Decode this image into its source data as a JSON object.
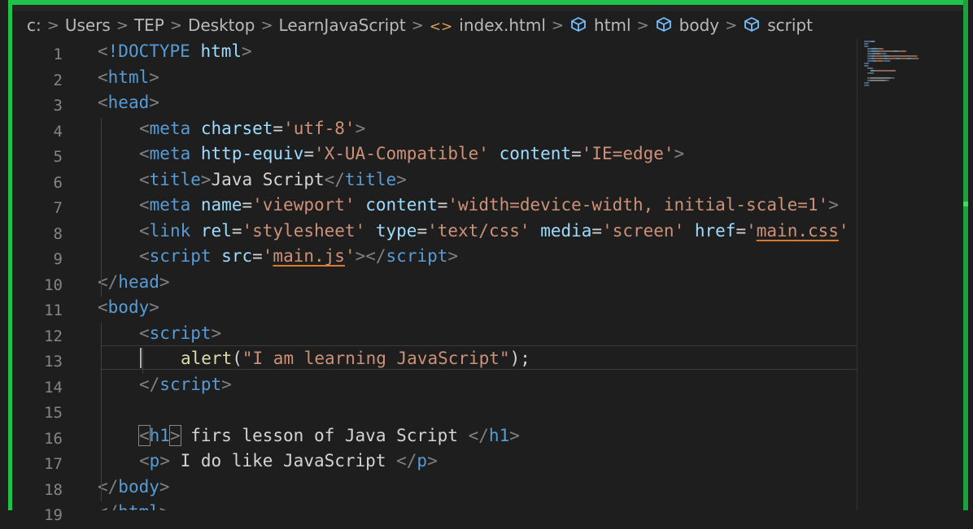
{
  "breadcrumb": {
    "items": [
      {
        "label": "c:",
        "icon": ""
      },
      {
        "label": "Users",
        "icon": ""
      },
      {
        "label": "TEP",
        "icon": ""
      },
      {
        "label": "Desktop",
        "icon": ""
      },
      {
        "label": "LearnJavaScript",
        "icon": ""
      },
      {
        "label": "index.html",
        "icon": "html-tag-icon"
      },
      {
        "label": "html",
        "icon": "symbol-cube-icon"
      },
      {
        "label": "body",
        "icon": "symbol-cube-icon"
      },
      {
        "label": "script",
        "icon": "symbol-cube-icon"
      }
    ],
    "separator": ">"
  },
  "editor": {
    "active_line": 13,
    "lines": [
      {
        "num": "1",
        "indent": 0,
        "tokens": [
          [
            "br",
            "<"
          ],
          [
            "tag",
            "!DOCTYPE"
          ],
          [
            "txt",
            " "
          ],
          [
            "attr",
            "html"
          ],
          [
            "br",
            ">"
          ]
        ]
      },
      {
        "num": "2",
        "indent": 0,
        "tokens": [
          [
            "br",
            "<"
          ],
          [
            "tag",
            "html"
          ],
          [
            "br",
            ">"
          ]
        ]
      },
      {
        "num": "3",
        "indent": 0,
        "tokens": [
          [
            "br",
            "<"
          ],
          [
            "tag",
            "head"
          ],
          [
            "br",
            ">"
          ]
        ]
      },
      {
        "num": "4",
        "indent": 1,
        "tokens": [
          [
            "br",
            "<"
          ],
          [
            "tag",
            "meta"
          ],
          [
            "txt",
            " "
          ],
          [
            "attr",
            "charset"
          ],
          [
            "txt",
            "="
          ],
          [
            "str",
            "'utf-8'"
          ],
          [
            "br",
            ">"
          ]
        ]
      },
      {
        "num": "5",
        "indent": 1,
        "tokens": [
          [
            "br",
            "<"
          ],
          [
            "tag",
            "meta"
          ],
          [
            "txt",
            " "
          ],
          [
            "attr",
            "http-equiv"
          ],
          [
            "txt",
            "="
          ],
          [
            "str",
            "'X-UA-Compatible'"
          ],
          [
            "txt",
            " "
          ],
          [
            "attr",
            "content"
          ],
          [
            "txt",
            "="
          ],
          [
            "str",
            "'IE=edge'"
          ],
          [
            "br",
            ">"
          ]
        ]
      },
      {
        "num": "6",
        "indent": 1,
        "tokens": [
          [
            "br",
            "<"
          ],
          [
            "tag",
            "title"
          ],
          [
            "br",
            ">"
          ],
          [
            "txt",
            "Java Script"
          ],
          [
            "br",
            "</"
          ],
          [
            "tag",
            "title"
          ],
          [
            "br",
            ">"
          ]
        ]
      },
      {
        "num": "7",
        "indent": 1,
        "tokens": [
          [
            "br",
            "<"
          ],
          [
            "tag",
            "meta"
          ],
          [
            "txt",
            " "
          ],
          [
            "attr",
            "name"
          ],
          [
            "txt",
            "="
          ],
          [
            "str",
            "'viewport'"
          ],
          [
            "txt",
            " "
          ],
          [
            "attr",
            "content"
          ],
          [
            "txt",
            "="
          ],
          [
            "str",
            "'width=device-width, initial-scale=1'"
          ],
          [
            "br",
            ">"
          ]
        ]
      },
      {
        "num": "8",
        "indent": 1,
        "tokens": [
          [
            "br",
            "<"
          ],
          [
            "tag",
            "link"
          ],
          [
            "txt",
            " "
          ],
          [
            "attr",
            "rel"
          ],
          [
            "txt",
            "="
          ],
          [
            "str",
            "'stylesheet'"
          ],
          [
            "txt",
            " "
          ],
          [
            "attr",
            "type"
          ],
          [
            "txt",
            "="
          ],
          [
            "str",
            "'text/css'"
          ],
          [
            "txt",
            " "
          ],
          [
            "attr",
            "media"
          ],
          [
            "txt",
            "="
          ],
          [
            "str",
            "'screen'"
          ],
          [
            "txt",
            " "
          ],
          [
            "attr",
            "href"
          ],
          [
            "txt",
            "="
          ],
          [
            "str",
            "'"
          ],
          [
            "strlink",
            "main.css"
          ],
          [
            "str",
            "'"
          ]
        ]
      },
      {
        "num": "9",
        "indent": 1,
        "tokens": [
          [
            "br",
            "<"
          ],
          [
            "tag",
            "script"
          ],
          [
            "txt",
            " "
          ],
          [
            "attr",
            "src"
          ],
          [
            "txt",
            "="
          ],
          [
            "str",
            "'"
          ],
          [
            "strlink",
            "main.js"
          ],
          [
            "str",
            "'"
          ],
          [
            "br",
            "></"
          ],
          [
            "tag",
            "script"
          ],
          [
            "br",
            ">"
          ]
        ]
      },
      {
        "num": "10",
        "indent": 0,
        "tokens": [
          [
            "br",
            "</"
          ],
          [
            "tag",
            "head"
          ],
          [
            "br",
            ">"
          ]
        ]
      },
      {
        "num": "11",
        "indent": 0,
        "tokens": [
          [
            "br",
            "<"
          ],
          [
            "tag",
            "body"
          ],
          [
            "br",
            ">"
          ]
        ]
      },
      {
        "num": "12",
        "indent": 1,
        "tokens": [
          [
            "br",
            "<"
          ],
          [
            "tag",
            "script"
          ],
          [
            "br",
            ">"
          ]
        ]
      },
      {
        "num": "13",
        "indent": 2,
        "tokens": [
          [
            "fn",
            "alert"
          ],
          [
            "txt",
            "("
          ],
          [
            "str",
            "\"I am learning JavaScript\""
          ],
          [
            "txt",
            ");"
          ]
        ]
      },
      {
        "num": "14",
        "indent": 1,
        "tokens": [
          [
            "br",
            "</"
          ],
          [
            "tag",
            "script"
          ],
          [
            "br",
            ">"
          ]
        ]
      },
      {
        "num": "15",
        "indent": 0,
        "tokens": []
      },
      {
        "num": "16",
        "indent": 1,
        "tokens": [
          [
            "brmatch",
            "<"
          ],
          [
            "tag",
            "h1"
          ],
          [
            "brmatch",
            ">"
          ],
          [
            "txt",
            " firs lesson of Java Script "
          ],
          [
            "br",
            "</"
          ],
          [
            "tag",
            "h1"
          ],
          [
            "br",
            ">"
          ]
        ]
      },
      {
        "num": "17",
        "indent": 1,
        "tokens": [
          [
            "br",
            "<"
          ],
          [
            "tag",
            "p"
          ],
          [
            "br",
            ">"
          ],
          [
            "txt",
            " I do like JavaScript "
          ],
          [
            "br",
            "</"
          ],
          [
            "tag",
            "p"
          ],
          [
            "br",
            ">"
          ]
        ]
      },
      {
        "num": "18",
        "indent": 0,
        "tokens": [
          [
            "br",
            "</"
          ],
          [
            "tag",
            "body"
          ],
          [
            "br",
            ">"
          ]
        ]
      },
      {
        "num": "19",
        "indent": 0,
        "tokens": [
          [
            "br",
            "</"
          ],
          [
            "tag",
            "html"
          ],
          [
            "br",
            ">"
          ]
        ]
      }
    ]
  },
  "colors": {
    "accent_border": "#22c24a",
    "background": "#1e1e1e",
    "tag": "#569cd6",
    "attribute": "#9cdcfe",
    "string": "#ce9178",
    "bracket": "#808080",
    "text": "#d4d4d4",
    "function": "#dcdcaa"
  }
}
